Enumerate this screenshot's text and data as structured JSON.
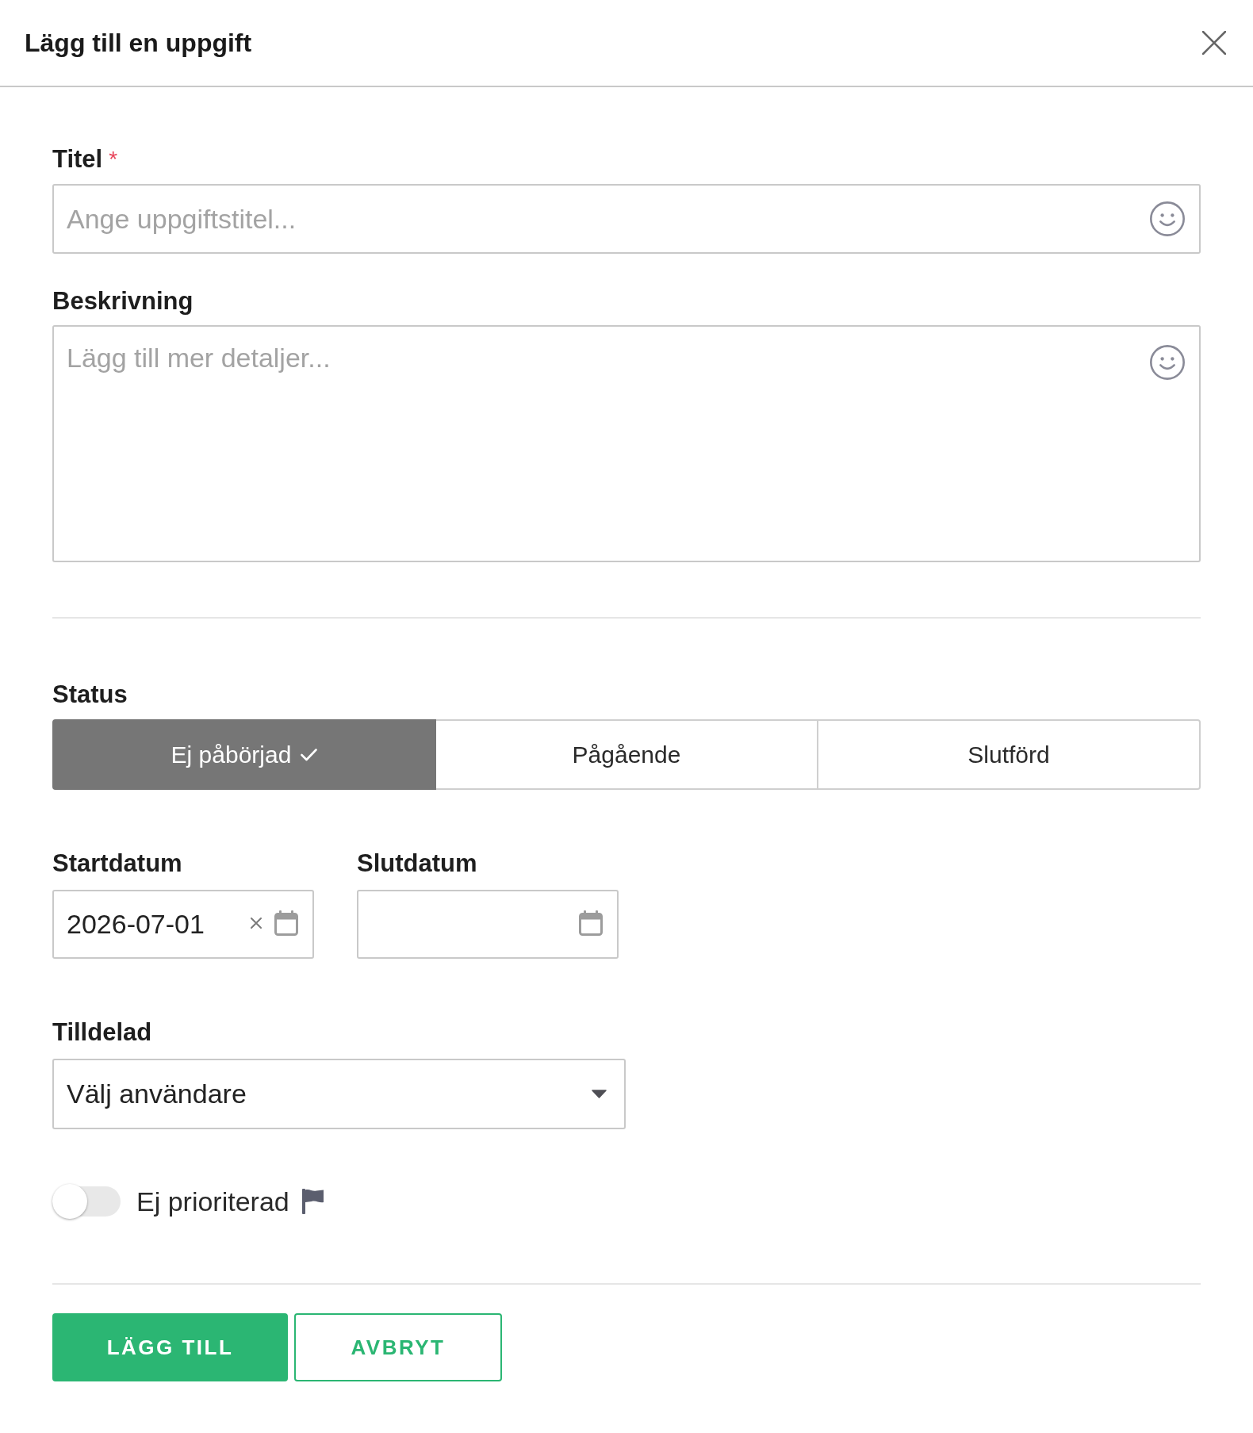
{
  "dialog": {
    "title": "Lägg till en uppgift"
  },
  "title_field": {
    "label": "Titel",
    "required_mark": "*",
    "placeholder": "Ange uppgiftstitel..."
  },
  "description_field": {
    "label": "Beskrivning",
    "placeholder": "Lägg till mer detaljer..."
  },
  "status": {
    "label": "Status",
    "options": [
      {
        "label": "Ej påbörjad",
        "selected": true
      },
      {
        "label": "Pågående",
        "selected": false
      },
      {
        "label": "Slutförd",
        "selected": false
      }
    ]
  },
  "dates": [
    {
      "label": "Startdatum",
      "value": "2026-07-01"
    },
    {
      "label": "Slutdatum"
    }
  ],
  "assignee": {
    "label": "Tilldelad",
    "value": "Välj användare"
  },
  "priority": {
    "label": "Ej prioriterad",
    "on": false
  },
  "actions": [
    {
      "label": "LÄGG TILL",
      "kind": "primary"
    },
    {
      "label": "AVBRYT",
      "kind": "secondary"
    }
  ]
}
